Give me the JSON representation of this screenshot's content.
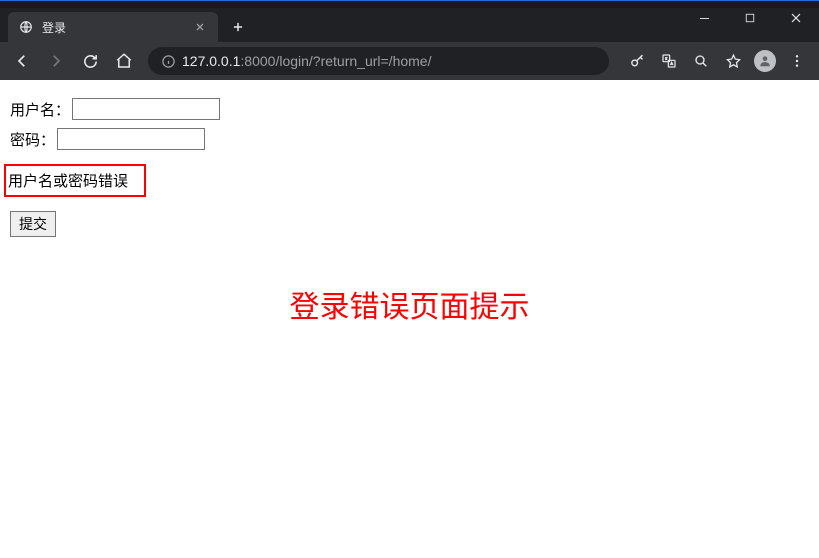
{
  "browser": {
    "tab_title": "登录",
    "url_host": "127.0.0.1",
    "url_port": ":8000",
    "url_path": "/login/?return_url=/home/"
  },
  "form": {
    "username_label": "用户名：",
    "password_label": "密码：",
    "error_message": "用户名或密码错误",
    "submit_label": "提交"
  },
  "annotation": {
    "text": "登录错误页面提示"
  }
}
